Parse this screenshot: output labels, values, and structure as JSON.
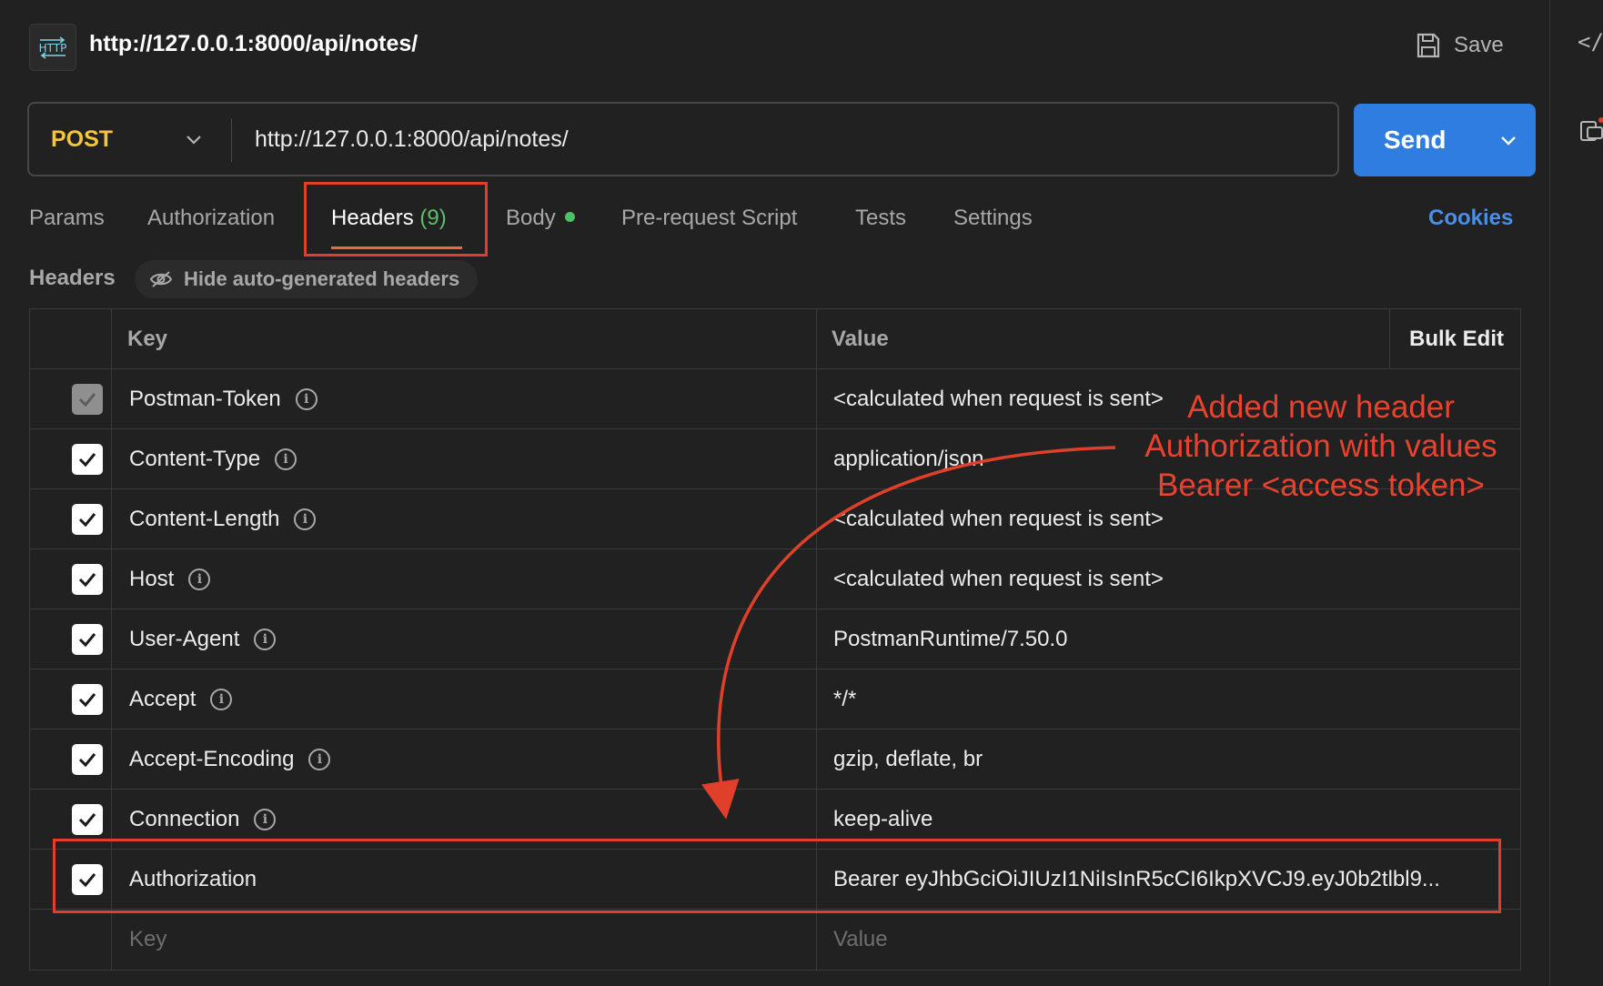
{
  "top_bar": {
    "icon_label": "HTTP",
    "title": "http://127.0.0.1:8000/api/notes/",
    "save_label": "Save",
    "code_icon": "</>"
  },
  "request": {
    "method": "POST",
    "url": "http://127.0.0.1:8000/api/notes/",
    "send_label": "Send"
  },
  "tabs": [
    {
      "label": "Params"
    },
    {
      "label": "Authorization"
    },
    {
      "label": "Headers",
      "count": "(9)",
      "active": true
    },
    {
      "label": "Body",
      "indicator": "green-dot"
    },
    {
      "label": "Pre-request Script"
    },
    {
      "label": "Tests"
    },
    {
      "label": "Settings"
    }
  ],
  "cookies_label": "Cookies",
  "headers_section": {
    "heading": "Headers",
    "hide_auto_label": "Hide auto-generated headers"
  },
  "table": {
    "col_key": "Key",
    "col_value": "Value",
    "bulk_edit": "Bulk Edit",
    "rows": [
      {
        "key": "Postman-Token",
        "value": "<calculated when request is sent>",
        "checked": true,
        "locked": true
      },
      {
        "key": "Content-Type",
        "value": "application/json",
        "checked": true
      },
      {
        "key": "Content-Length",
        "value": "<calculated when request is sent>",
        "checked": true
      },
      {
        "key": "Host",
        "value": "<calculated when request is sent>",
        "checked": true
      },
      {
        "key": "User-Agent",
        "value": "PostmanRuntime/7.50.0",
        "checked": true
      },
      {
        "key": "Accept",
        "value": "*/*",
        "checked": true
      },
      {
        "key": "Accept-Encoding",
        "value": "gzip, deflate, br",
        "checked": true
      },
      {
        "key": "Connection",
        "value": "keep-alive",
        "checked": true
      },
      {
        "key": "Authorization",
        "value": "Bearer eyJhbGciOiJIUzI1NiIsInR5cCI6IkpXVCJ9.eyJ0b2tlbl9...",
        "checked": true
      }
    ],
    "new_key_placeholder": "Key",
    "new_value_placeholder": "Value"
  },
  "annotation": {
    "text": "Added new header\nAuthorization with values\nBearer <access token>",
    "color": "#e8432e"
  },
  "colors": {
    "background": "#212121",
    "method": "#f5c542",
    "send": "#2f7de1",
    "tab_underline": "#f06a33",
    "count": "#5bc06a",
    "cookies": "#4a8fe7"
  }
}
